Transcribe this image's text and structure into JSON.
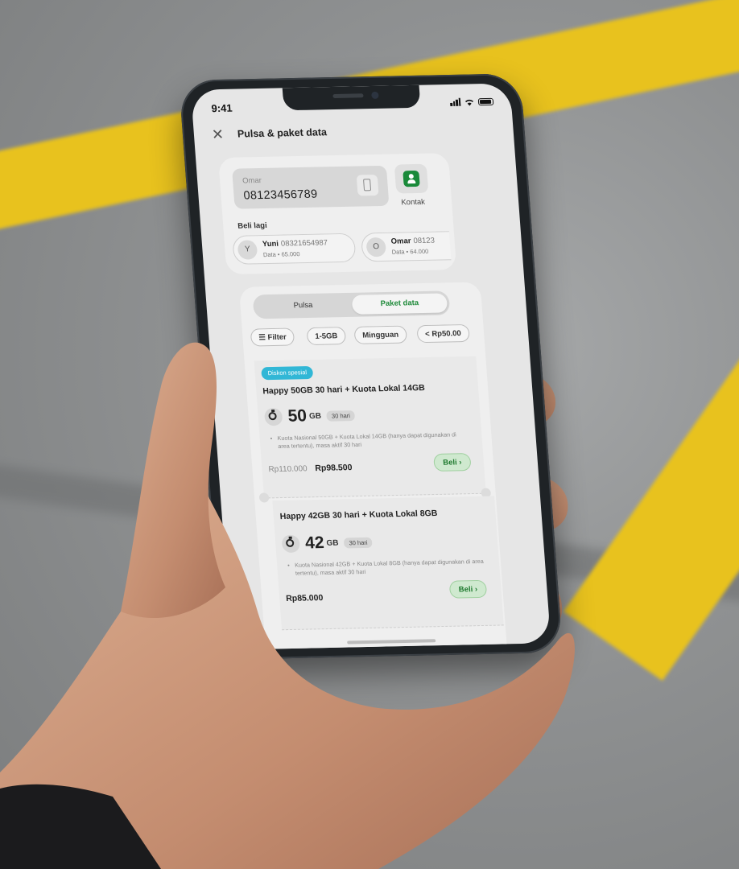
{
  "status": {
    "time": "9:41"
  },
  "header": {
    "title": "Pulsa & paket data"
  },
  "number": {
    "name": "Omar",
    "value": "08123456789",
    "contact_label": "Kontak"
  },
  "recent": {
    "label": "Beli lagi",
    "items": [
      {
        "initial": "Y",
        "name": "Yuni",
        "phone": "08321654987",
        "detail": "Data • 65.000"
      },
      {
        "initial": "O",
        "name": "Omar",
        "phone": "08123",
        "detail": "Data • 64.000"
      }
    ]
  },
  "tabs": {
    "pulsa": "Pulsa",
    "paket": "Paket data",
    "active": "Paket data"
  },
  "filters": [
    "Filter",
    "1-5GB",
    "Mingguan",
    "< Rp50.00"
  ],
  "plans": [
    {
      "badge": "Diskon spesial",
      "title": "Happy 50GB 30 hari + Kuota Lokal 14GB",
      "quota": "50",
      "unit": "GB",
      "days": "30 hari",
      "desc": "Kuota Nasional 50GB + Kuota Lokal 14GB (hanya dapat digunakan di area tertentu), masa aktif 30 hari",
      "price_old": "Rp110.000",
      "price": "Rp98.500",
      "cta": "Beli ›"
    },
    {
      "badge": "",
      "title": "Happy 42GB 30 hari + Kuota Lokal 8GB",
      "quota": "42",
      "unit": "GB",
      "days": "30 hari",
      "desc": "Kuota Nasional 42GB + Kuota Lokal 8GB (hanya dapat digunakan di area tertentu), masa aktif 30 hari",
      "price_old": "",
      "price": "Rp85.000",
      "cta": "Beli ›"
    }
  ],
  "colors": {
    "accent_green": "#1f8a3a",
    "badge_cyan": "#31b7d6",
    "road_yellow": "#e8c21e"
  }
}
